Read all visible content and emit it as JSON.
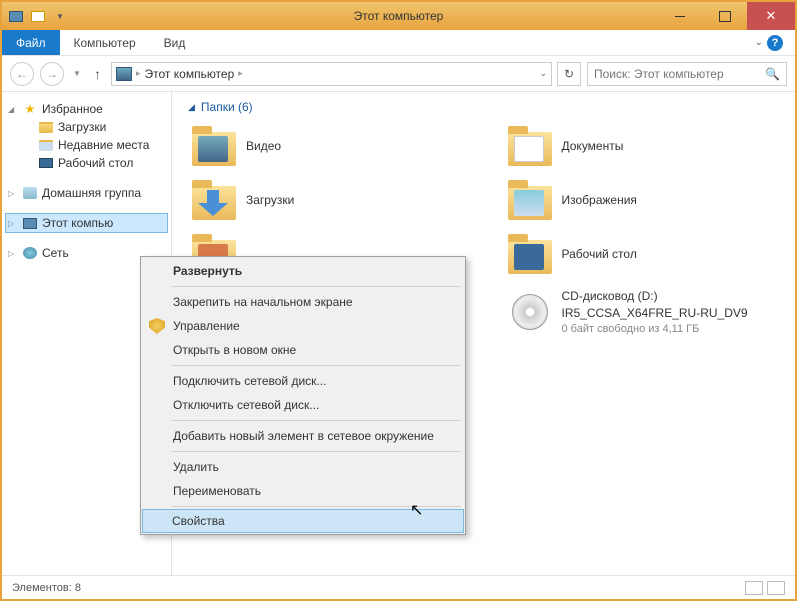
{
  "titlebar": {
    "title": "Этот компьютер"
  },
  "ribbon": {
    "file": "Файл",
    "tabs": [
      "Компьютер",
      "Вид"
    ]
  },
  "nav": {
    "up_arrow": "↑",
    "crumb": "Этот компьютер",
    "search_placeholder": "Поиск: Этот компьютер"
  },
  "tree": {
    "favorites": "Избранное",
    "fav_items": [
      "Загрузки",
      "Недавние места",
      "Рабочий стол"
    ],
    "homegroup": "Домашняя группа",
    "thispc": "Этот компью",
    "network": "Сеть"
  },
  "content": {
    "section": "Папки (6)",
    "folders": [
      {
        "label": "Видео",
        "kind": "video"
      },
      {
        "label": "Документы",
        "kind": "docs"
      },
      {
        "label": "Загрузки",
        "kind": "down"
      },
      {
        "label": "Изображения",
        "kind": "img"
      },
      {
        "label": "",
        "kind": "music"
      },
      {
        "label": "Рабочий стол",
        "kind": "desk"
      }
    ],
    "drive": {
      "line1": "CD-дисковод (D:)",
      "line2": "IR5_CCSA_X64FRE_RU-RU_DV9",
      "line3": "0 байт свободно из 4,11 ГБ"
    }
  },
  "ctx": {
    "items": [
      {
        "label": "Развернуть",
        "bold": true
      },
      {
        "sep": true
      },
      {
        "label": "Закрепить на начальном экране"
      },
      {
        "label": "Управление",
        "icon": "shield"
      },
      {
        "label": "Открыть в новом окне"
      },
      {
        "sep": true
      },
      {
        "label": "Подключить сетевой диск..."
      },
      {
        "label": "Отключить сетевой диск..."
      },
      {
        "sep": true
      },
      {
        "label": "Добавить новый элемент в сетевое окружение"
      },
      {
        "sep": true
      },
      {
        "label": "Удалить"
      },
      {
        "label": "Переименовать"
      },
      {
        "sep": true
      },
      {
        "label": "Свойства",
        "hl": true
      }
    ]
  },
  "status": {
    "text": "Элементов: 8"
  }
}
